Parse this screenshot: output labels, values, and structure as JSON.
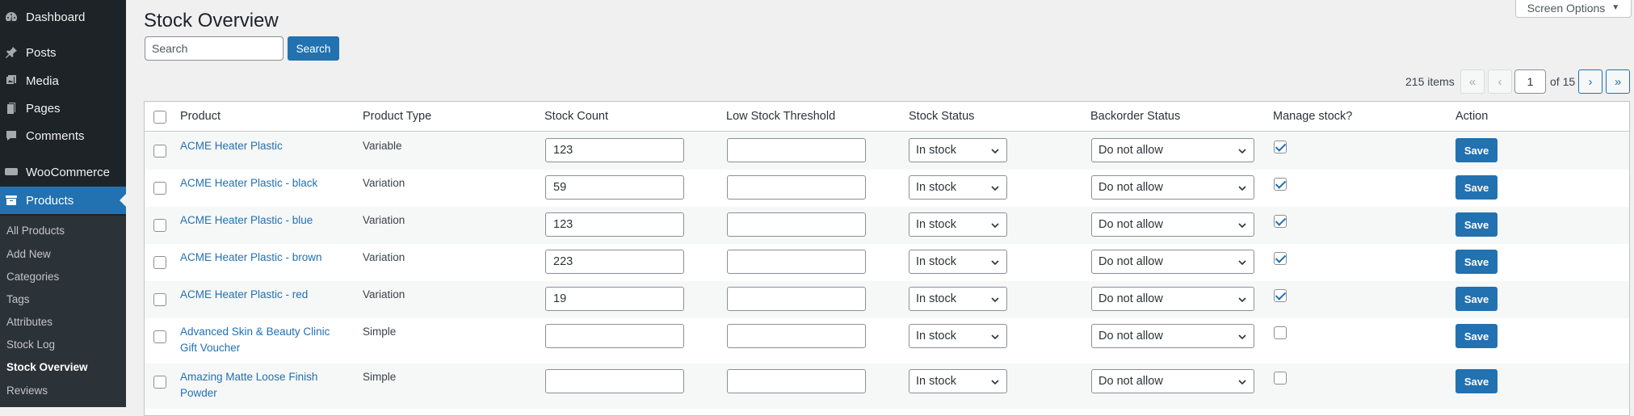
{
  "sidebar": {
    "menu": [
      {
        "label": "Dashboard",
        "icon": "dashboard-icon"
      },
      {
        "label": "Posts",
        "icon": "pin-icon"
      },
      {
        "label": "Media",
        "icon": "media-icon"
      },
      {
        "label": "Pages",
        "icon": "pages-icon"
      },
      {
        "label": "Comments",
        "icon": "comment-icon"
      },
      {
        "label": "WooCommerce",
        "icon": "woocommerce-icon"
      },
      {
        "label": "Products",
        "icon": "archive-icon",
        "current": true
      }
    ],
    "submenu": [
      {
        "label": "All Products"
      },
      {
        "label": "Add New"
      },
      {
        "label": "Categories"
      },
      {
        "label": "Tags"
      },
      {
        "label": "Attributes"
      },
      {
        "label": "Stock Log"
      },
      {
        "label": "Stock Overview",
        "current": true
      },
      {
        "label": "Reviews"
      }
    ]
  },
  "header": {
    "title": "Stock Overview",
    "screen_options": "Screen Options"
  },
  "search": {
    "placeholder": "Search",
    "button_label": "Search"
  },
  "pagination": {
    "items_count": "215 items",
    "first": "«",
    "prev": "‹",
    "current_page": "1",
    "of_label": "of 15",
    "next": "›",
    "last": "»"
  },
  "table": {
    "columns": {
      "product": "Product",
      "type": "Product Type",
      "stock_count": "Stock Count",
      "low_threshold": "Low Stock Threshold",
      "stock_status": "Stock Status",
      "backorder": "Backorder Status",
      "manage": "Manage stock?",
      "action": "Action"
    },
    "rows": [
      {
        "name_line1": "ACME Heater Plastic",
        "name_line2": "",
        "type": "Variable",
        "stock": "123",
        "threshold": "",
        "status": "In stock",
        "backorder": "Do not allow",
        "manage": true,
        "save": "Save"
      },
      {
        "name_line1": "ACME Heater Plastic - black",
        "name_line2": "",
        "type": "Variation",
        "stock": "59",
        "threshold": "",
        "status": "In stock",
        "backorder": "Do not allow",
        "manage": true,
        "save": "Save"
      },
      {
        "name_line1": "ACME Heater Plastic - blue",
        "name_line2": "",
        "type": "Variation",
        "stock": "123",
        "threshold": "",
        "status": "In stock",
        "backorder": "Do not allow",
        "manage": true,
        "save": "Save"
      },
      {
        "name_line1": "ACME Heater Plastic - brown",
        "name_line2": "",
        "type": "Variation",
        "stock": "223",
        "threshold": "",
        "status": "In stock",
        "backorder": "Do not allow",
        "manage": true,
        "save": "Save"
      },
      {
        "name_line1": "ACME Heater Plastic - red",
        "name_line2": "",
        "type": "Variation",
        "stock": "19",
        "threshold": "",
        "status": "In stock",
        "backorder": "Do not allow",
        "manage": true,
        "save": "Save"
      },
      {
        "name_line1": "Advanced Skin & Beauty Clinic",
        "name_line2": "Gift Voucher",
        "type": "Simple",
        "stock": "",
        "threshold": "",
        "status": "In stock",
        "backorder": "Do not allow",
        "manage": false,
        "save": "Save"
      },
      {
        "name_line1": "Amazing Matte Loose Finish",
        "name_line2": "Powder",
        "type": "Simple",
        "stock": "",
        "threshold": "",
        "status": "In stock",
        "backorder": "Do not allow",
        "manage": false,
        "save": "Save"
      }
    ]
  },
  "colors": {
    "sidebar_bg": "#1d2327",
    "submenu_bg": "#2c3338",
    "accent": "#2271b1",
    "page_bg": "#f0f0f1"
  }
}
